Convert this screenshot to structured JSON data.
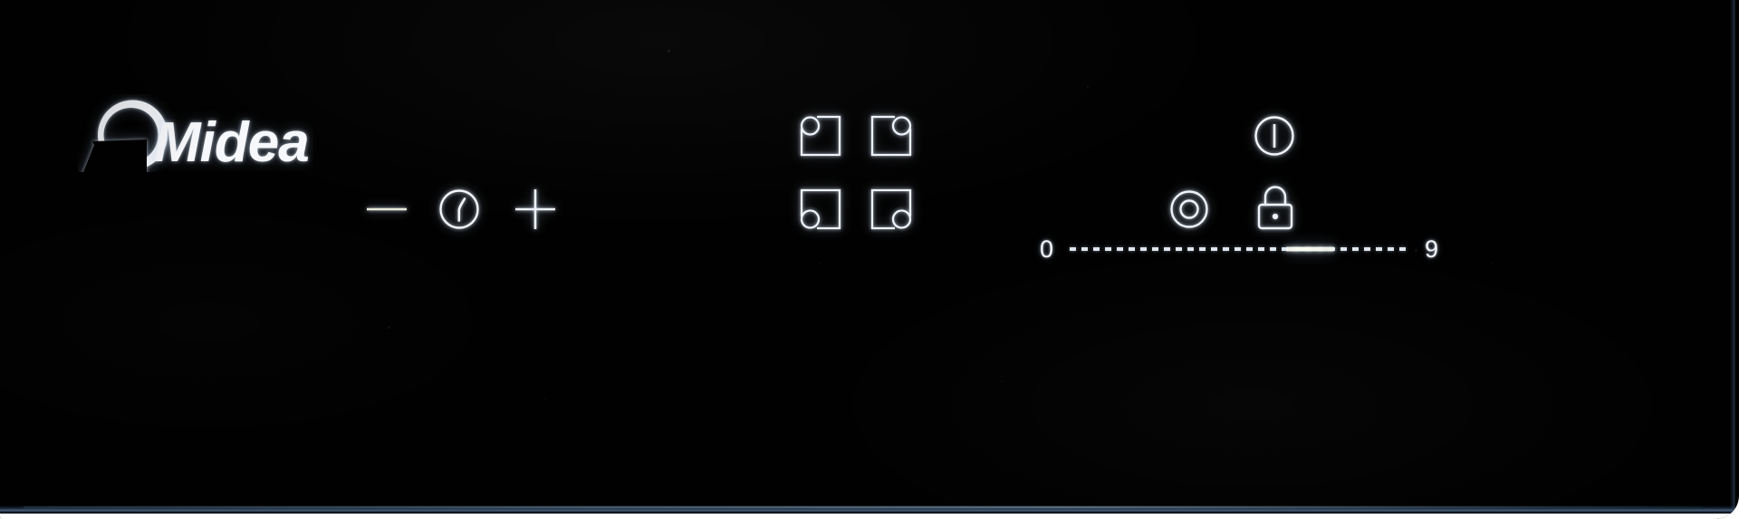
{
  "device": {
    "brand": "Midea",
    "surface_color": "#010101",
    "icon_color": "#f2f4f7",
    "accent_color": "#e8ecd9",
    "edge_color": "#5a7ea6"
  },
  "brand": {
    "wordmark": "Midea",
    "logo_icon": "midea-crescent-logo"
  },
  "timer_controls": {
    "decrease": {
      "label": "−",
      "icon": "minus-icon"
    },
    "timer": {
      "label": "Timer",
      "icon": "clock-icon"
    },
    "increase": {
      "label": "+",
      "icon": "plus-icon"
    }
  },
  "cooking_zones": [
    {
      "id": "zone-rear-left",
      "icon": "zone-top-left-icon",
      "position": "rear-left",
      "row": "top",
      "marker": "top-left"
    },
    {
      "id": "zone-rear-right",
      "icon": "zone-top-right-icon",
      "position": "rear-right",
      "row": "top",
      "marker": "top-right"
    },
    {
      "id": "zone-front-left",
      "icon": "zone-bottom-left-icon",
      "position": "front-left",
      "row": "bottom",
      "marker": "bottom-left"
    },
    {
      "id": "zone-front-right",
      "icon": "zone-bottom-right-icon",
      "position": "front-right",
      "row": "bottom",
      "marker": "bottom-right"
    }
  ],
  "power_slider": {
    "min_label": "0",
    "max_label": "9",
    "min_value": 0,
    "max_value": 9,
    "current_value": 7,
    "fill_percent": 78
  },
  "function_buttons": {
    "keep_warm": {
      "icon": "concentric-circles-icon",
      "label": "Keep Warm"
    },
    "child_lock": {
      "icon": "padlock-icon",
      "label": "Lock"
    }
  },
  "power_button": {
    "icon": "power-icon",
    "label": "On / Off"
  }
}
